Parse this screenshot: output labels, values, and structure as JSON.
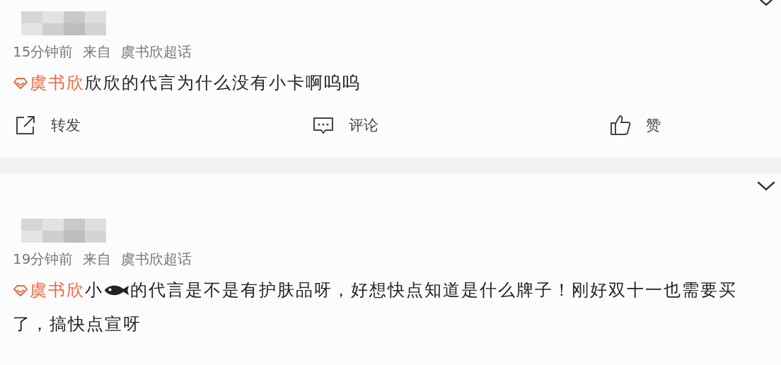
{
  "posts": [
    {
      "name_redacted": true,
      "time": "15分钟前",
      "source_label": "来自",
      "source": "虞书欣超话",
      "topic": "虞书欣",
      "body": [
        {
          "kind": "text",
          "text": "欣欣的代言为什么没有小卡啊呜呜"
        }
      ],
      "actions": [
        {
          "kind": "share",
          "label": "转发"
        },
        {
          "kind": "comment",
          "label": "评论"
        },
        {
          "kind": "like",
          "label": "赞"
        }
      ]
    },
    {
      "name_redacted": true,
      "time": "19分钟前",
      "source_label": "来自",
      "source": "虞书欣超话",
      "topic": "虞书欣",
      "body": [
        {
          "kind": "text",
          "text": "小"
        },
        {
          "kind": "emoji"
        },
        {
          "kind": "text",
          "text": "的代言是不是有护肤品呀，好想快点知道是什么牌子！刚好双十一也需要买了，搞快点宣呀"
        }
      ]
    }
  ]
}
